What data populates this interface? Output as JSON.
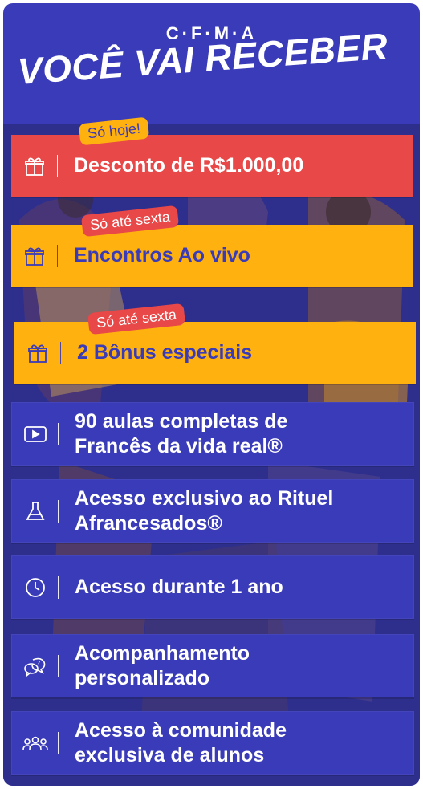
{
  "brand": "C·F·M·A",
  "headline": "VOCÊ VAI RECEBER",
  "colors": {
    "card": "#3a3bb8",
    "red": "#e84848",
    "yellow": "#ffb20f",
    "white": "#ffffff"
  },
  "items": [
    {
      "icon": "gift-icon",
      "tag": "Só hoje!",
      "text": "Desconto de R$1.000,00"
    },
    {
      "icon": "gift-icon",
      "tag": "Só até sexta",
      "text": "Encontros Ao vivo"
    },
    {
      "icon": "gift-icon",
      "tag": "Só até sexta",
      "text": "2 Bônus especiais"
    },
    {
      "icon": "video-play-icon",
      "text_line1": "90 aulas completas de",
      "text_line2": "Francês da vida real®"
    },
    {
      "icon": "flask-icon",
      "text_line1": "Acesso exclusivo ao Rituel",
      "text_line2": "Afrancesados®"
    },
    {
      "icon": "clock-icon",
      "text": "Acesso durante 1 ano"
    },
    {
      "icon": "chat-question-icon",
      "text_line1": "Acompanhamento",
      "text_line2": "personalizado"
    },
    {
      "icon": "community-icon",
      "text_line1": "Acesso à comunidade",
      "text_line2": "exclusiva de alunos"
    }
  ]
}
